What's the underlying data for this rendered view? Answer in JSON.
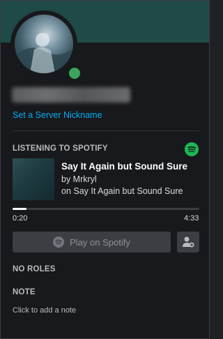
{
  "profile": {
    "set_nickname_label": "Set a Server Nickname",
    "status": "online",
    "status_color": "#3ba55c",
    "banner_color": "#1f4a48"
  },
  "activity": {
    "heading": "LISTENING TO SPOTIFY",
    "icon": "spotify-icon",
    "song_title": "Say It Again but Sound Sure",
    "artist_line": "by Mrkryl",
    "album_line": "on Say It Again but Sound Sure",
    "elapsed": "0:20",
    "duration": "4:33",
    "progress_fraction": 0.073,
    "play_button_label": "Play on Spotify",
    "play_icon": "spotify-icon",
    "add_friend_icon": "add-friend-icon"
  },
  "roles": {
    "heading": "NO ROLES"
  },
  "note": {
    "heading": "NOTE",
    "placeholder": "Click to add a note"
  }
}
